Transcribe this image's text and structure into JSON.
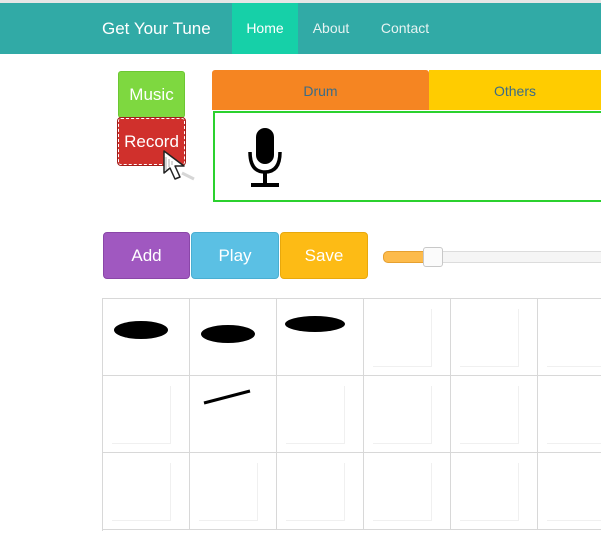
{
  "navbar": {
    "brand": "Get Your Tune",
    "items": [
      {
        "label": "Home",
        "active": true
      },
      {
        "label": "About",
        "active": false
      },
      {
        "label": "Contact",
        "active": false
      }
    ]
  },
  "side_buttons": {
    "music": "Music",
    "record": "Record"
  },
  "tabs": [
    {
      "label": "Drum"
    },
    {
      "label": "Others"
    }
  ],
  "panel": {
    "icon": "microphone-icon"
  },
  "actions": {
    "add": "Add",
    "play": "Play",
    "save": "Save"
  },
  "slider": {
    "level_fraction": 0.22
  },
  "grid": {
    "rows": 3,
    "cols": 6,
    "cells": [
      [
        "snare-drum-icon",
        "snare-drum-sticks-icon",
        "bass-drum-icon",
        "",
        "",
        ""
      ],
      [
        "",
        "drum-kit-icon",
        "",
        "",
        "",
        ""
      ],
      [
        "",
        "",
        "",
        "",
        "",
        ""
      ]
    ]
  },
  "colors": {
    "navbar": "#31aaa6",
    "nav_active": "#16d0a8",
    "music": "#7ed840",
    "record": "#d0302c",
    "tab_drum": "#f58522",
    "tab_others": "#ffcc00",
    "panel_border": "#2bd12e",
    "add": "#a058c0",
    "play": "#5bc0e4",
    "save": "#fdbb15"
  }
}
